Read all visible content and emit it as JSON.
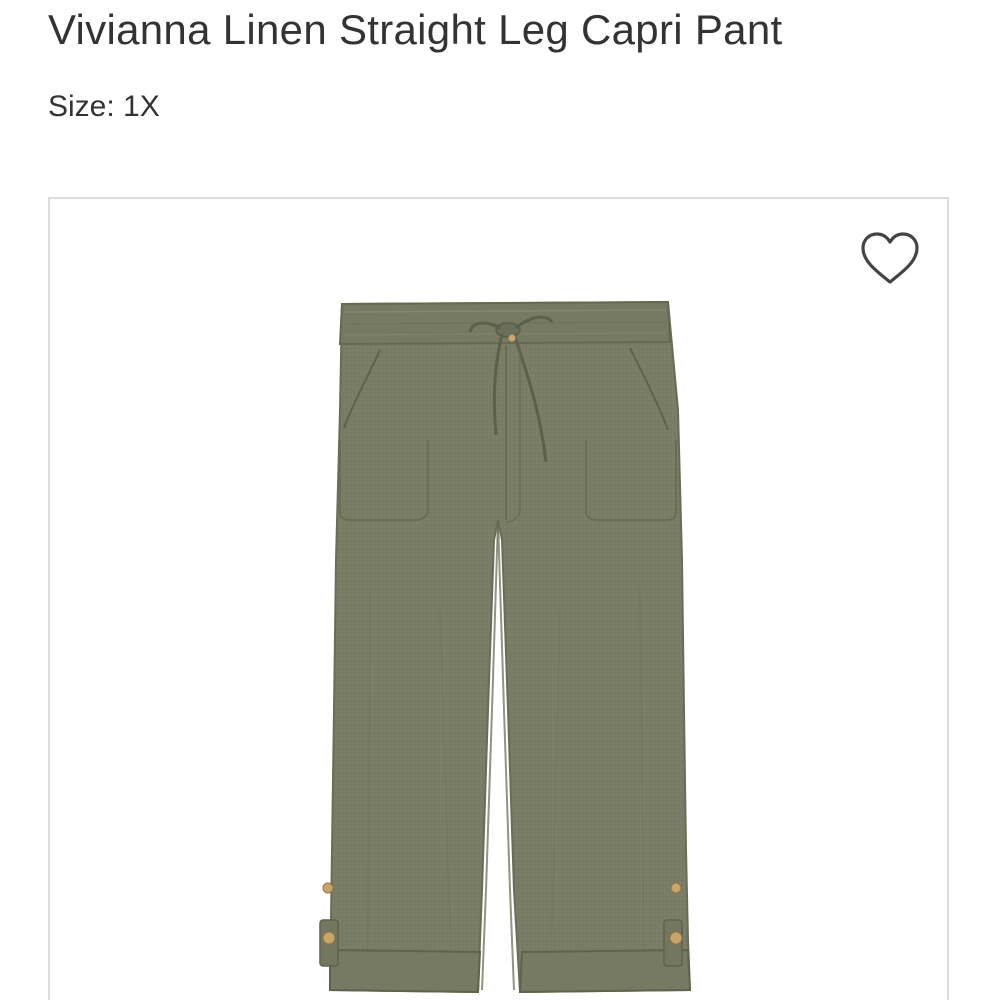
{
  "product": {
    "title": "Vivianna Linen Straight Leg Capri Pant",
    "size_label": "Size: 1X"
  },
  "image": {
    "subject": "olive green linen capri pants",
    "fabric_color": "#7a7d65"
  },
  "favorite": {
    "icon": "heart-outline-icon"
  }
}
